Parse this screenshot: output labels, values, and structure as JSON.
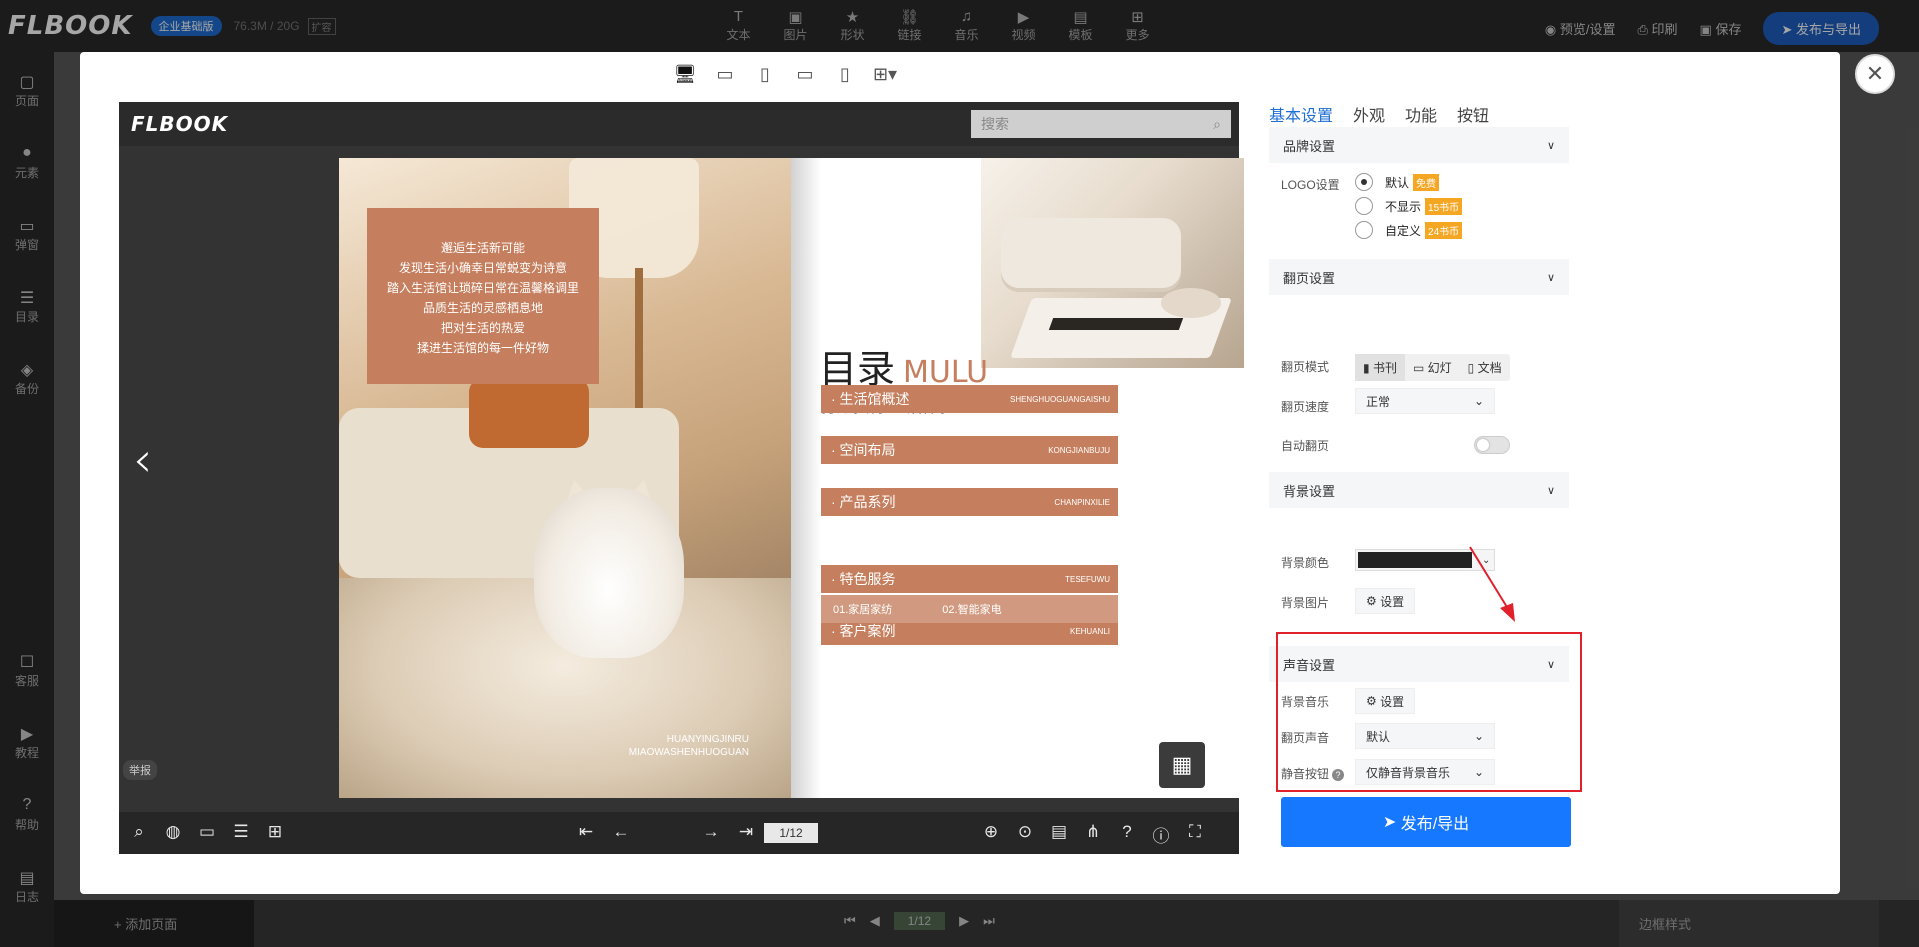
{
  "app": {
    "brand": "FLBOOK",
    "edition_badge": "企业基础版",
    "storage": "76.3M / 20G",
    "storage_tag": "扩容",
    "toolbar": [
      {
        "label": "文本",
        "icon": "T"
      },
      {
        "label": "图片",
        "icon": "▣"
      },
      {
        "label": "形状",
        "icon": "★"
      },
      {
        "label": "链接",
        "icon": "⛓"
      },
      {
        "label": "音乐",
        "icon": "♫"
      },
      {
        "label": "视频",
        "icon": "▶"
      },
      {
        "label": "模板",
        "icon": "▤"
      },
      {
        "label": "更多",
        "icon": "⊞"
      }
    ],
    "top_actions": {
      "preview": "预览/设置",
      "print": "印刷",
      "save": "保存",
      "publish": "发布与导出"
    },
    "left_nav": [
      {
        "label": "页面",
        "icon": "▢"
      },
      {
        "label": "元素",
        "icon": "●"
      },
      {
        "label": "弹窗",
        "icon": "▭"
      },
      {
        "label": "目录",
        "icon": "☰"
      },
      {
        "label": "备份",
        "icon": "◈"
      },
      {
        "label": "客服",
        "icon": "☐"
      },
      {
        "label": "教程",
        "icon": "▶"
      },
      {
        "label": "帮助",
        "icon": "?"
      },
      {
        "label": "日志",
        "icon": "▤"
      }
    ],
    "bottom": {
      "add_page": "+ 添加页面",
      "page": "1/12",
      "border_style": "边框样式"
    }
  },
  "viewer": {
    "logo": "FLBOOK",
    "search_placeholder": "搜索",
    "report": "举报",
    "page_indicator": "1/12",
    "left_quote": [
      "邂逅生活新可能",
      "发现生活小确幸日常蜕变为诗意",
      "踏入生活馆让琐碎日常在温馨格调里",
      "品质生活的灵感栖息地",
      "把对生活的热爱",
      "揉进生活馆的每一件好物"
    ],
    "left_caption": [
      "HUANYINGJINRU",
      "MIAOWASHENHUOGUAN"
    ],
    "toc_title": "目录",
    "toc_title_en": "MULU",
    "toc_subtitle": "打造独特·生活体验",
    "toc_items": [
      {
        "zh": "· 生活馆概述",
        "en": "SHENGHUOGUANGAISHU"
      },
      {
        "zh": "· 空间布局",
        "en": "KONGJIANBUJU"
      },
      {
        "zh": "· 产品系列",
        "en": "CHANPINXILIE"
      },
      {
        "zh": "· 特色服务",
        "en": "TESEFUWU"
      },
      {
        "zh": "· 客户案例",
        "en": "KEHUANLI"
      }
    ],
    "toc_subrow": [
      "01.家居家纺",
      "02.智能家电"
    ]
  },
  "settings": {
    "tabs": [
      "基本设置",
      "外观",
      "功能",
      "按钮"
    ],
    "brand_section": "品牌设置",
    "logo_label": "LOGO设置",
    "logo_options": [
      {
        "label": "默认",
        "price": "免费",
        "selected": true
      },
      {
        "label": "不显示",
        "price": "15书币",
        "selected": false
      },
      {
        "label": "自定义",
        "price": "24书币",
        "selected": false
      }
    ],
    "flip_section": "翻页设置",
    "flip_mode_label": "翻页模式",
    "flip_modes": [
      "书刊",
      "幻灯",
      "文档"
    ],
    "flip_speed_label": "翻页速度",
    "flip_speed_value": "正常",
    "auto_flip_label": "自动翻页",
    "auto_flip": false,
    "bg_section": "背景设置",
    "bg_color_label": "背景颜色",
    "bg_color": "#222222",
    "bg_image_label": "背景图片",
    "set_label": "设置",
    "sound_section": "声音设置",
    "bg_music_label": "背景音乐",
    "flip_sound_label": "翻页声音",
    "flip_sound_value": "默认",
    "mute_label": "静音按钮",
    "mute_value": "仅静音背景音乐",
    "publish_button": "发布/导出"
  },
  "colors": {
    "accent": "#1677ff",
    "highlight": "#e0202a",
    "toc": "#c57f5e"
  }
}
